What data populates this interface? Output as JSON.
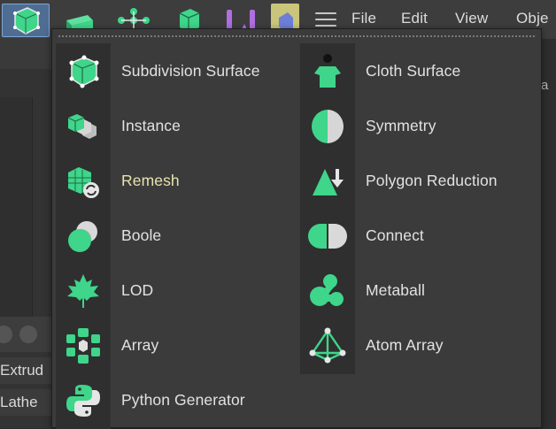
{
  "menubar": {
    "items": [
      "File",
      "Edit",
      "View",
      "Obje"
    ]
  },
  "toolbar": {
    "icons": [
      "subdivision-surface-icon",
      "extrude-icon",
      "mograph-icon",
      "cube-icon",
      "deformer-icon",
      "camera-icon"
    ]
  },
  "side_panel": {
    "items": [
      "Extrud",
      "Lathe"
    ]
  },
  "right_panel": {
    "label": "a"
  },
  "dropdown": {
    "left_column": [
      {
        "label": "Subdivision Surface",
        "icon": "subdivision-surface-icon"
      },
      {
        "label": "Instance",
        "icon": "instance-icon"
      },
      {
        "label": "Remesh",
        "icon": "remesh-icon"
      },
      {
        "label": "Boole",
        "icon": "boole-icon"
      },
      {
        "label": "LOD",
        "icon": "lod-icon"
      },
      {
        "label": "Array",
        "icon": "array-icon"
      },
      {
        "label": "Python Generator",
        "icon": "python-icon"
      }
    ],
    "right_column": [
      {
        "label": "Cloth Surface",
        "icon": "cloth-surface-icon"
      },
      {
        "label": "Symmetry",
        "icon": "symmetry-icon"
      },
      {
        "label": "Polygon Reduction",
        "icon": "polygon-reduction-icon"
      },
      {
        "label": "Connect",
        "icon": "connect-icon"
      },
      {
        "label": "Metaball",
        "icon": "metaball-icon"
      },
      {
        "label": "Atom Array",
        "icon": "atom-array-icon"
      }
    ]
  },
  "colors": {
    "accent_green": "#3fd58a",
    "highlight_text": "#e7e2b0",
    "menu_bg": "#3b3b3b",
    "icon_column_bg": "#2f2f2f"
  }
}
